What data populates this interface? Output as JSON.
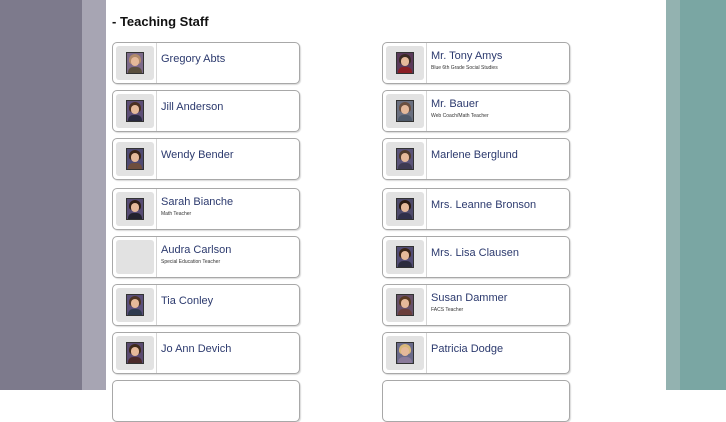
{
  "section": {
    "title": "- Teaching Staff"
  },
  "staff": [
    {
      "name": "Gregory Abts",
      "title": "",
      "photo": true,
      "bg": "#7d6a8a",
      "hair": "#b08a6a",
      "shirt": "#5a4f3e"
    },
    {
      "name": "Mr. Tony Amys",
      "title": "Blue 6th Grade Social Studies",
      "photo": true,
      "bg": "#5a3a5a",
      "hair": "#3a2a22",
      "shirt": "#8a1e24"
    },
    {
      "name": "Jill Anderson",
      "title": "",
      "photo": true,
      "bg": "#5d4e76",
      "hair": "#4a3022",
      "shirt": "#2a2a40"
    },
    {
      "name": "Mr. Bauer",
      "title": "Web Coach/Math Teacher",
      "photo": true,
      "bg": "#6a6f7f",
      "hair": "#6a5040",
      "shirt": "#4f5a6a"
    },
    {
      "name": "Wendy Bender",
      "title": "",
      "photo": true,
      "bg": "#4f4a72",
      "hair": "#3a2418",
      "shirt": "#6e4e3e"
    },
    {
      "name": "Marlene Berglund",
      "title": "",
      "photo": true,
      "bg": "#5a5378",
      "hair": "#4e3a2c",
      "shirt": "#3e3a52"
    },
    {
      "name": "Sarah Bianche",
      "title": "Math Teacher",
      "photo": true,
      "bg": "#564b73",
      "hair": "#2e1e16",
      "shirt": "#22222e"
    },
    {
      "name": "Mrs. Leanne Bronson",
      "title": "",
      "photo": true,
      "bg": "#4e4a6a",
      "hair": "#2a1a12",
      "shirt": "#30304a"
    },
    {
      "name": "Audra Carlson",
      "title": "Special Education Teacher",
      "photo": false
    },
    {
      "name": "Mrs. Lisa Clausen",
      "title": "",
      "photo": true,
      "bg": "#524c74",
      "hair": "#3a2418",
      "shirt": "#2c2c3e"
    },
    {
      "name": "Tia Conley",
      "title": "",
      "photo": true,
      "bg": "#5a4f7a",
      "hair": "#4e3424",
      "shirt": "#2e3a4e"
    },
    {
      "name": "Susan Dammer",
      "title": "FACS Teacher",
      "photo": true,
      "bg": "#665068",
      "hair": "#5a3a22",
      "shirt": "#6a3e3a"
    },
    {
      "name": "Jo Ann Devich",
      "title": "",
      "photo": true,
      "bg": "#5a4a70",
      "hair": "#3e2a1a",
      "shirt": "#4a2a2a"
    },
    {
      "name": "Patricia Dodge",
      "title": "",
      "photo": true,
      "bg": "#6a6a8a",
      "hair": "#d8b87a",
      "shirt": "#8a7a9a"
    }
  ],
  "colors": {
    "left_band": "#7d7a8c",
    "right_band": "#7aa6a3",
    "name_text": "#2c3a6e"
  }
}
